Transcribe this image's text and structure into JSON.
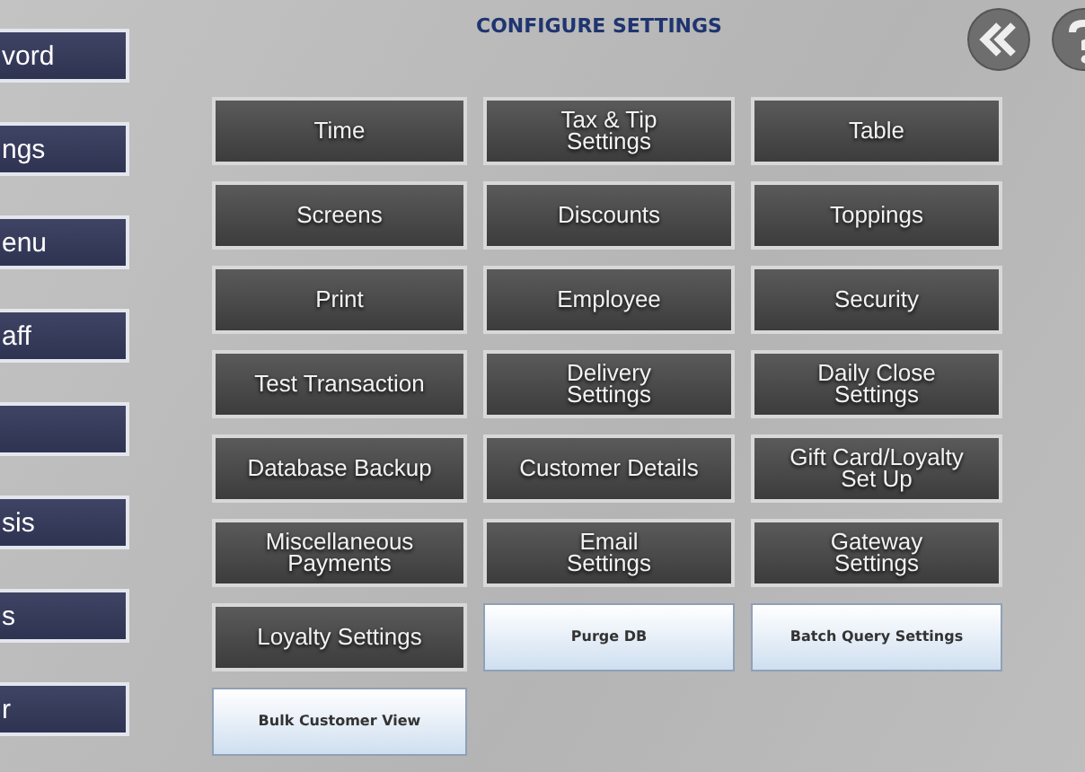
{
  "sidebar": {
    "items": [
      {
        "kind": "text",
        "label": "vord"
      },
      {
        "kind": "text",
        "label": "ngs"
      },
      {
        "kind": "text",
        "label": "enu"
      },
      {
        "kind": "text",
        "label": "aff"
      },
      {
        "kind": "blank"
      },
      {
        "kind": "text",
        "label": "sis"
      },
      {
        "kind": "text",
        "label": "s"
      },
      {
        "kind": "text",
        "label": "r"
      }
    ]
  },
  "title": "CONFIGURE SETTINGS",
  "buttons": [
    {
      "label": "Time",
      "kind": "dark"
    },
    {
      "label": "Tax & Tip\nSettings",
      "kind": "dark"
    },
    {
      "label": "Table",
      "kind": "dark"
    },
    {
      "label": "Screens",
      "kind": "dark"
    },
    {
      "label": "Discounts",
      "kind": "dark"
    },
    {
      "label": "Toppings",
      "kind": "dark"
    },
    {
      "label": "Print",
      "kind": "dark"
    },
    {
      "label": "Employee",
      "kind": "dark"
    },
    {
      "label": "Security",
      "kind": "dark"
    },
    {
      "label": "Test Transaction",
      "kind": "dark"
    },
    {
      "label": "Delivery\nSettings",
      "kind": "dark"
    },
    {
      "label": "Daily Close\nSettings",
      "kind": "dark"
    },
    {
      "label": "Database Backup",
      "kind": "dark"
    },
    {
      "label": "Customer Details",
      "kind": "dark"
    },
    {
      "label": "Gift Card/Loyalty\nSet Up",
      "kind": "dark"
    },
    {
      "label": "Miscellaneous\nPayments",
      "kind": "dark"
    },
    {
      "label": "Email\nSettings",
      "kind": "dark"
    },
    {
      "label": "Gateway\nSettings",
      "kind": "dark"
    },
    {
      "label": "Loyalty Settings",
      "kind": "dark"
    },
    {
      "label": "Purge DB",
      "kind": "light"
    },
    {
      "label": "Batch Query Settings",
      "kind": "light"
    },
    {
      "label": "Bulk Customer View",
      "kind": "light"
    }
  ]
}
